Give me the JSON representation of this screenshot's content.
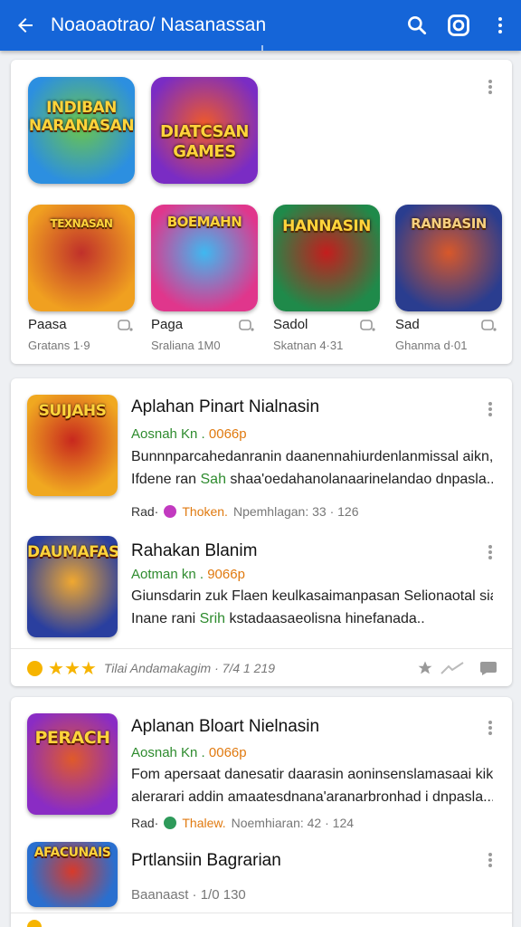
{
  "app_bar": {
    "title": "Noaoaotrao/ Nasanassan"
  },
  "featured": {
    "tiles": [
      {
        "art_text": "INDIBAN NARANASAN",
        "colors": [
          "#2c8fe0",
          "#6cc64a"
        ]
      },
      {
        "art_text": "DIATCSAN GAMES",
        "colors": [
          "#7a2cc4",
          "#f05a28"
        ]
      },
      {
        "art_text": "TEXNASAN",
        "colors": [
          "#f0a020",
          "#c0302a"
        ]
      },
      {
        "art_text": "BOEMAHN",
        "colors": [
          "#e0368c",
          "#3fb8f0"
        ]
      },
      {
        "art_text": "HANNASIN",
        "colors": [
          "#1f8a4a",
          "#c41d1d"
        ]
      },
      {
        "art_text": "RANBASIN",
        "colors": [
          "#2a3d8f",
          "#d8582a"
        ]
      }
    ],
    "items": [
      {
        "name": "Paasa",
        "sub": "Gratans 1·9"
      },
      {
        "name": "Paga",
        "sub": "Sraliana 1M0"
      },
      {
        "name": "Sadol",
        "sub": "Skatnan 4·31"
      },
      {
        "name": "Sad",
        "sub": "Ghanma d·01"
      }
    ]
  },
  "list1": [
    {
      "title": "Aplahan Pinart Nialnasin",
      "meta_green": "Aosnah Kn .",
      "meta_orange": "0066p",
      "desc_line1": "Bunnnparcahedanranin daanennahiurdenlanmissal aikn,",
      "desc_line2_pre": "Ifdene ran ",
      "desc_line2_green": "Sah",
      "desc_line2_post": " shaa'oedahanolanaarinelandao dnpasla...",
      "foot_pre": "Rad·",
      "foot_orange": "Thoken.",
      "foot_post": "Npemhlagan: 33 · 126",
      "art_text": "SUIJAHS",
      "colors": [
        "#f0a820",
        "#c8281e"
      ],
      "icon_color": "#c23ac0"
    },
    {
      "title": "Rahakan Blanim",
      "meta_green": "Aotman kn .",
      "meta_orange": "9066p",
      "desc_line1": "Giunsdarin zuk Flaen keulkasaimanpasan Selionaotal siad,",
      "desc_line2_pre": "Inane rani ",
      "desc_line2_green": "Srih",
      "desc_line2_post": " kstadaasaeolisna hinefanada..",
      "art_text": "DAUMAFASM",
      "colors": [
        "#2a3f9f",
        "#f0a830"
      ]
    }
  ],
  "rating_row": {
    "text": "Tilai Andamakagim · 7/4 1 219",
    "stars": 3
  },
  "list2": [
    {
      "title": "Aplanan Bloart Nielnasin",
      "meta_green": "Aosnah Kn .",
      "meta_orange": "0066p",
      "desc_line1": "Fom apersaat danesatir daarasin aoninsenslamasaai kikn,",
      "desc_line2": "alerarari addin amaatesdnana'aranarbronhad i dnpasla...",
      "foot_pre": "Rad·",
      "foot_orange": "Thalew.",
      "foot_post": "Noemhiaran: 42 · 124",
      "art_text": "PERACH",
      "colors": [
        "#8a2cc4",
        "#e05a2a"
      ],
      "icon_color": "#2e9a5a"
    },
    {
      "title": "Prtlansiin Bagrarian",
      "sub": "Baanaast · 1/0 130",
      "art_text": "AFACUNAIS",
      "colors": [
        "#2a6fcf",
        "#d83a2a"
      ]
    }
  ]
}
